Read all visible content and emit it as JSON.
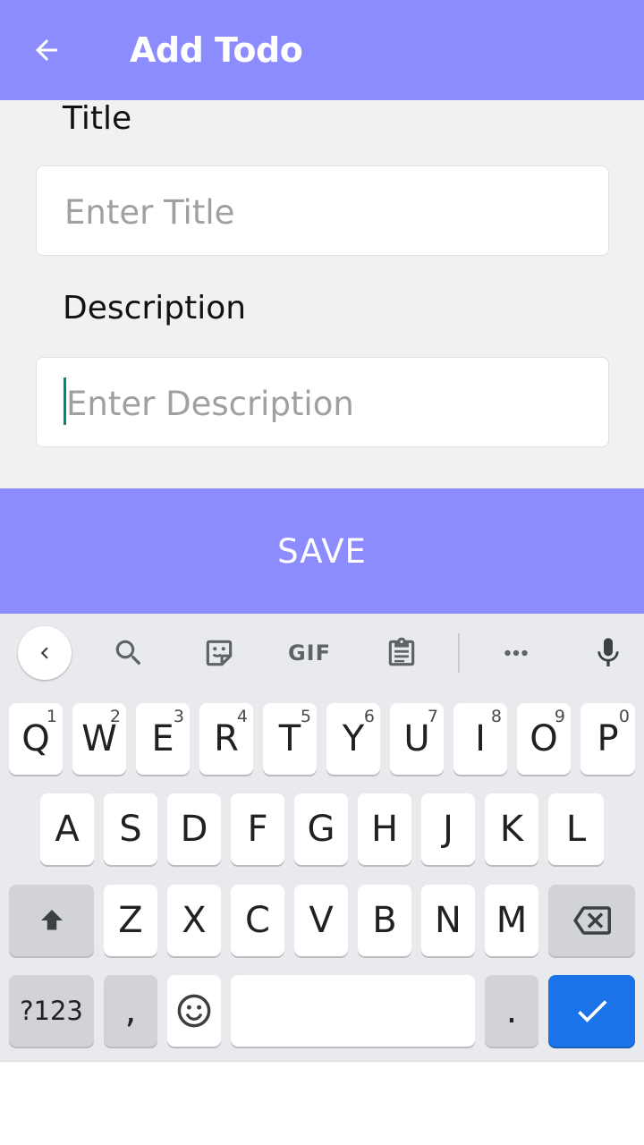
{
  "appbar": {
    "title": "Add Todo",
    "back_icon": "arrow-back-icon",
    "color": "#8c8cff"
  },
  "form": {
    "title_label": "Title",
    "title_placeholder": "Enter Title",
    "description_label": "Description",
    "description_placeholder": "Enter Description"
  },
  "save_button": {
    "label": "SAVE",
    "color": "#8c8cff"
  },
  "keyboard": {
    "toolbar": [
      "chevron-left-icon",
      "search-icon",
      "sticker-icon",
      "gif-icon",
      "clipboard-icon",
      "more-icon",
      "mic-icon"
    ],
    "gif_label": "GIF",
    "row1": [
      {
        "k": "Q",
        "h": "1"
      },
      {
        "k": "W",
        "h": "2"
      },
      {
        "k": "E",
        "h": "3"
      },
      {
        "k": "R",
        "h": "4"
      },
      {
        "k": "T",
        "h": "5"
      },
      {
        "k": "Y",
        "h": "6"
      },
      {
        "k": "U",
        "h": "7"
      },
      {
        "k": "I",
        "h": "8"
      },
      {
        "k": "O",
        "h": "9"
      },
      {
        "k": "P",
        "h": "0"
      }
    ],
    "row2": [
      "A",
      "S",
      "D",
      "F",
      "G",
      "H",
      "J",
      "K",
      "L"
    ],
    "row3": [
      "Z",
      "X",
      "C",
      "V",
      "B",
      "N",
      "M"
    ],
    "symbols_label": "?123",
    "comma_label": ",",
    "period_label": ".",
    "enter_color": "#1a73e8"
  }
}
